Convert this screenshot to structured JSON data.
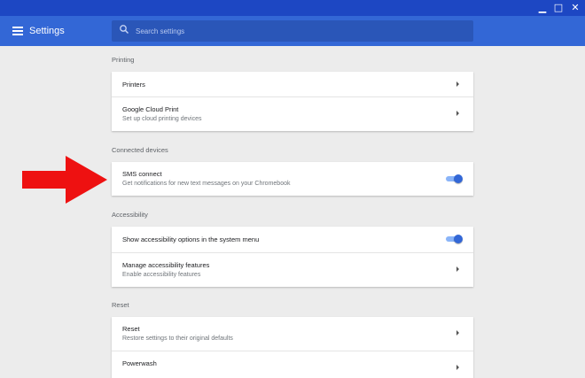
{
  "window": {
    "minimize_glyph": "▁",
    "maximize_glyph": "□",
    "close_glyph": "✕"
  },
  "app": {
    "title": "Settings",
    "search_placeholder": "Search settings"
  },
  "sections": {
    "printing": {
      "title": "Printing",
      "printers": {
        "title": "Printers"
      },
      "cloud_print": {
        "title": "Google Cloud Print",
        "subtitle": "Set up cloud printing devices"
      }
    },
    "connected": {
      "title": "Connected devices",
      "sms": {
        "title": "SMS connect",
        "subtitle": "Get notifications for new text messages on your Chromebook",
        "enabled": true
      }
    },
    "accessibility": {
      "title": "Accessibility",
      "show_options": {
        "title": "Show accessibility options in the system menu",
        "enabled": true
      },
      "manage": {
        "title": "Manage accessibility features",
        "subtitle": "Enable accessibility features"
      }
    },
    "reset": {
      "title": "Reset",
      "reset": {
        "title": "Reset",
        "subtitle": "Restore settings to their original defaults"
      },
      "powerwash": {
        "title": "Powerwash"
      }
    }
  },
  "colors": {
    "titlebar": "#1d47c3",
    "appbar": "#3367d6",
    "toggle_on": "#3367d6",
    "annotation_arrow": "#ee1111"
  },
  "icons": [
    "menu-icon",
    "search-icon",
    "chevron-right-icon",
    "toggle-switch"
  ]
}
